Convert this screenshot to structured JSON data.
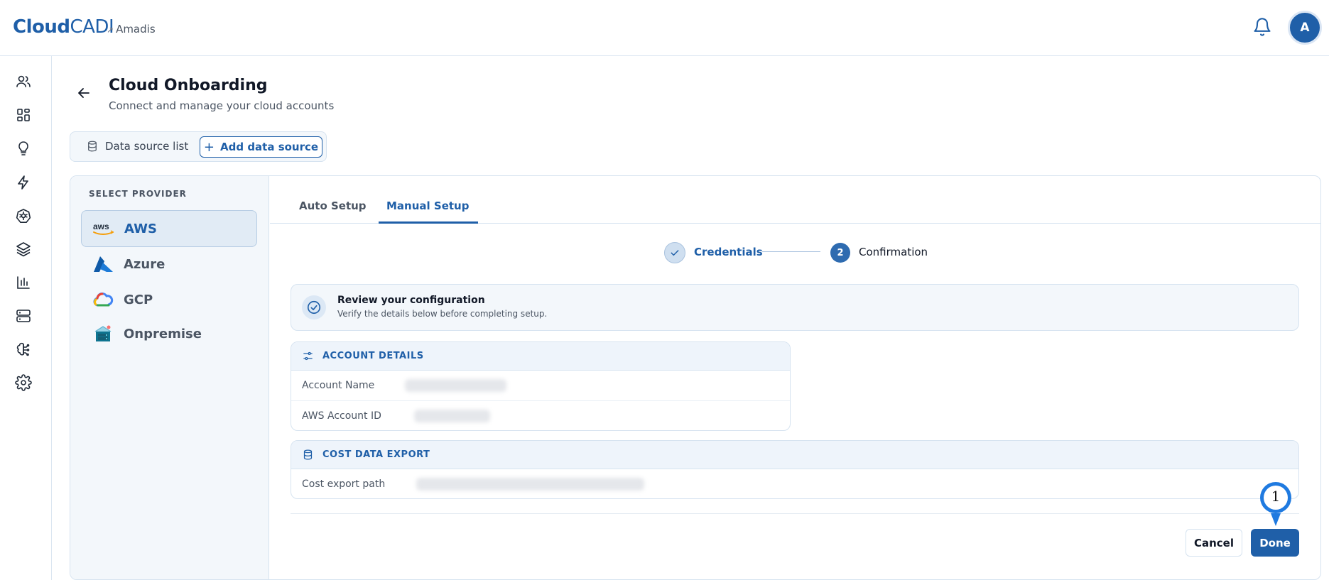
{
  "topbar": {
    "brand_bold": "Cloud",
    "brand_light": "CADI",
    "org_name": "Amadis",
    "avatar_initial": "A"
  },
  "header": {
    "title": "Cloud Onboarding",
    "subtitle": "Connect and manage your cloud accounts"
  },
  "switcher": {
    "list_label": "Data source list",
    "add_label": "Add data source"
  },
  "providers": {
    "heading": "SELECT PROVIDER",
    "items": [
      {
        "label": "AWS",
        "active": true
      },
      {
        "label": "Azure",
        "active": false
      },
      {
        "label": "GCP",
        "active": false
      },
      {
        "label": "Onpremise",
        "active": false
      }
    ]
  },
  "tabs": [
    {
      "label": "Auto Setup",
      "active": false
    },
    {
      "label": "Manual Setup",
      "active": true
    }
  ],
  "stepper": {
    "step1_label": "Credentials",
    "step2_number": "2",
    "step2_label": "Confirmation"
  },
  "review": {
    "title": "Review your configuration",
    "subtitle": "Verify the details below before completing setup."
  },
  "account_details": {
    "heading": "ACCOUNT DETAILS",
    "rows": [
      {
        "label": "Account Name"
      },
      {
        "label": "AWS Account ID"
      }
    ]
  },
  "cost_export": {
    "heading": "COST DATA EXPORT",
    "rows": [
      {
        "label": "Cost export path"
      }
    ]
  },
  "actions": {
    "cancel_label": "Cancel",
    "done_label": "Done"
  },
  "marker": {
    "number": "1"
  },
  "colors": {
    "accent": "#1f5fa8",
    "panel_bg": "#f3f7fb",
    "border": "#d6e3f0"
  }
}
